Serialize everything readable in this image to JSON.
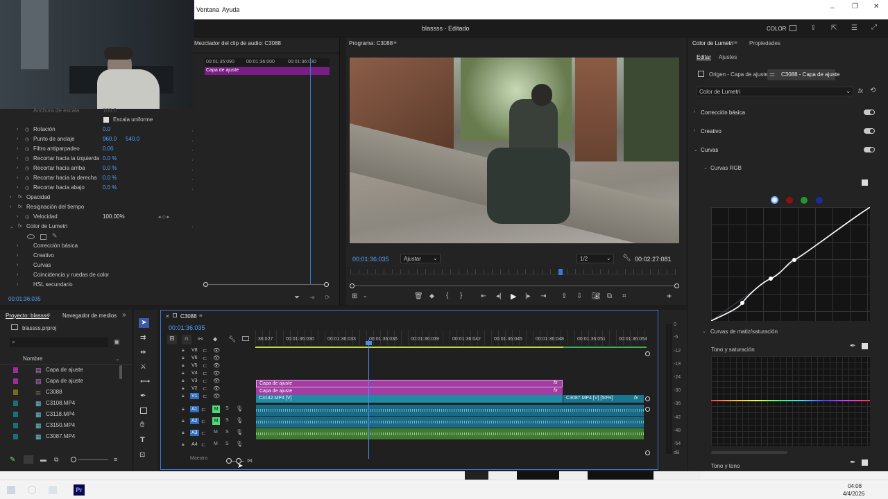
{
  "menu": {
    "items": [
      "Ventana",
      "Ayuda"
    ]
  },
  "app": {
    "title": "blassss - Editado",
    "workspace": "COLOR"
  },
  "audio_mixer": {
    "title": "Mezclador del clip de audio: C3088",
    "ruler": [
      "00:01:35:090",
      "00:01:36:000",
      "00:01:36:030"
    ],
    "clip_label": "Capa de ajuste"
  },
  "effect_controls": {
    "rows": [
      {
        "label": "Anchura de escala",
        "value": "100.0"
      },
      {
        "label": "Escala uniforme",
        "value": ""
      },
      {
        "label": "Rotación",
        "value": "0.0"
      },
      {
        "label": "Punto de anclaje",
        "value": "960.0",
        "value2": "540.0"
      },
      {
        "label": "Filtro antiparpadeo",
        "value": "0.00"
      },
      {
        "label": "Recortar hacia la izquierda",
        "value": "0.0 %"
      },
      {
        "label": "Recortar hacia arriba",
        "value": "0.0 %"
      },
      {
        "label": "Recortar hacia la derecha",
        "value": "0.0 %"
      },
      {
        "label": "Recortar hacia abajo",
        "value": "0.0 %"
      },
      {
        "label": "Opacidad",
        "value": ""
      },
      {
        "label": "Resignación del tiempo",
        "value": ""
      },
      {
        "label": "Velocidad",
        "value": "100.00%"
      },
      {
        "label": "Color de Lumetri",
        "value": ""
      }
    ],
    "lumetri_sub": [
      "Corrección básica",
      "Creativo",
      "Curvas",
      "Coincidencia y ruedas de color",
      "HSL secundario"
    ],
    "timecode": "00:01:36:035"
  },
  "program": {
    "title": "Programa: C3088",
    "timecode": "00:01:36:035",
    "fit": "Ajustar",
    "resolution": "1/2",
    "duration": "00:02:27:081"
  },
  "project": {
    "tabs": [
      "Proyecto: blassss",
      "Navegador de medios"
    ],
    "file": "blassss.prproj",
    "column": "Nombre",
    "items": [
      {
        "name": "Capa de ajuste",
        "color": "#9a2f9a"
      },
      {
        "name": "Capa de ajuste",
        "color": "#9a2f9a"
      },
      {
        "name": "C3088",
        "color": "#7a6a1a"
      },
      {
        "name": "C3108.MP4",
        "color": "#1a6f7a"
      },
      {
        "name": "C3118.MP4",
        "color": "#1a6f7a"
      },
      {
        "name": "C3150.MP4",
        "color": "#1a6f7a"
      },
      {
        "name": "C3087.MP4",
        "color": "#1a6f7a"
      }
    ]
  },
  "timeline": {
    "tab": "C3088",
    "timecode": "00:01:36:035",
    "ruler": [
      ":36:027",
      "00:01:36:030",
      "00:01:36:033",
      "00:01:36:036",
      "00:01:36:039",
      "00:01:36:042",
      "00:01:36:045",
      "00:01:36:048",
      "00:01:36:051",
      "00:01:36:054"
    ],
    "video_tracks": [
      "V8",
      "V6",
      "V5",
      "V4",
      "V3",
      "V2",
      "V1"
    ],
    "audio_tracks": [
      "A1",
      "A2",
      "A3",
      "A4"
    ],
    "clips": {
      "v3": "Capa de ajuste",
      "v2": "Capa de ajuste",
      "v1a": "C3142.MP4 [V]",
      "v1b": "C3087.MP4 [V] [50%]"
    },
    "master": "Maestro"
  },
  "meter": {
    "scale": [
      "0",
      "-6",
      "-12",
      "-18",
      "-24",
      "-30",
      "-36",
      "-42",
      "-48",
      "-54",
      "dB"
    ]
  },
  "lumetri": {
    "tabs": [
      "Color de Lumetri",
      "Propiedades"
    ],
    "subtabs": [
      "Editar",
      "Ajustes"
    ],
    "sources": [
      "Origen - Capa de ajuste",
      "C3088 - Capa de ajuste"
    ],
    "effect": "Color de Lumetri",
    "sections": [
      "Corrección básica",
      "Creativo",
      "Curvas"
    ],
    "curves_rgb": "Curvas RGB",
    "hue_sat_title": "Curvas de matiz/saturación",
    "hue_sat_label": "Tono y saturación",
    "hue_hue_label": "Tono y tono"
  },
  "taskbar": {
    "time": "04:08",
    "date": "4/4/2026"
  }
}
